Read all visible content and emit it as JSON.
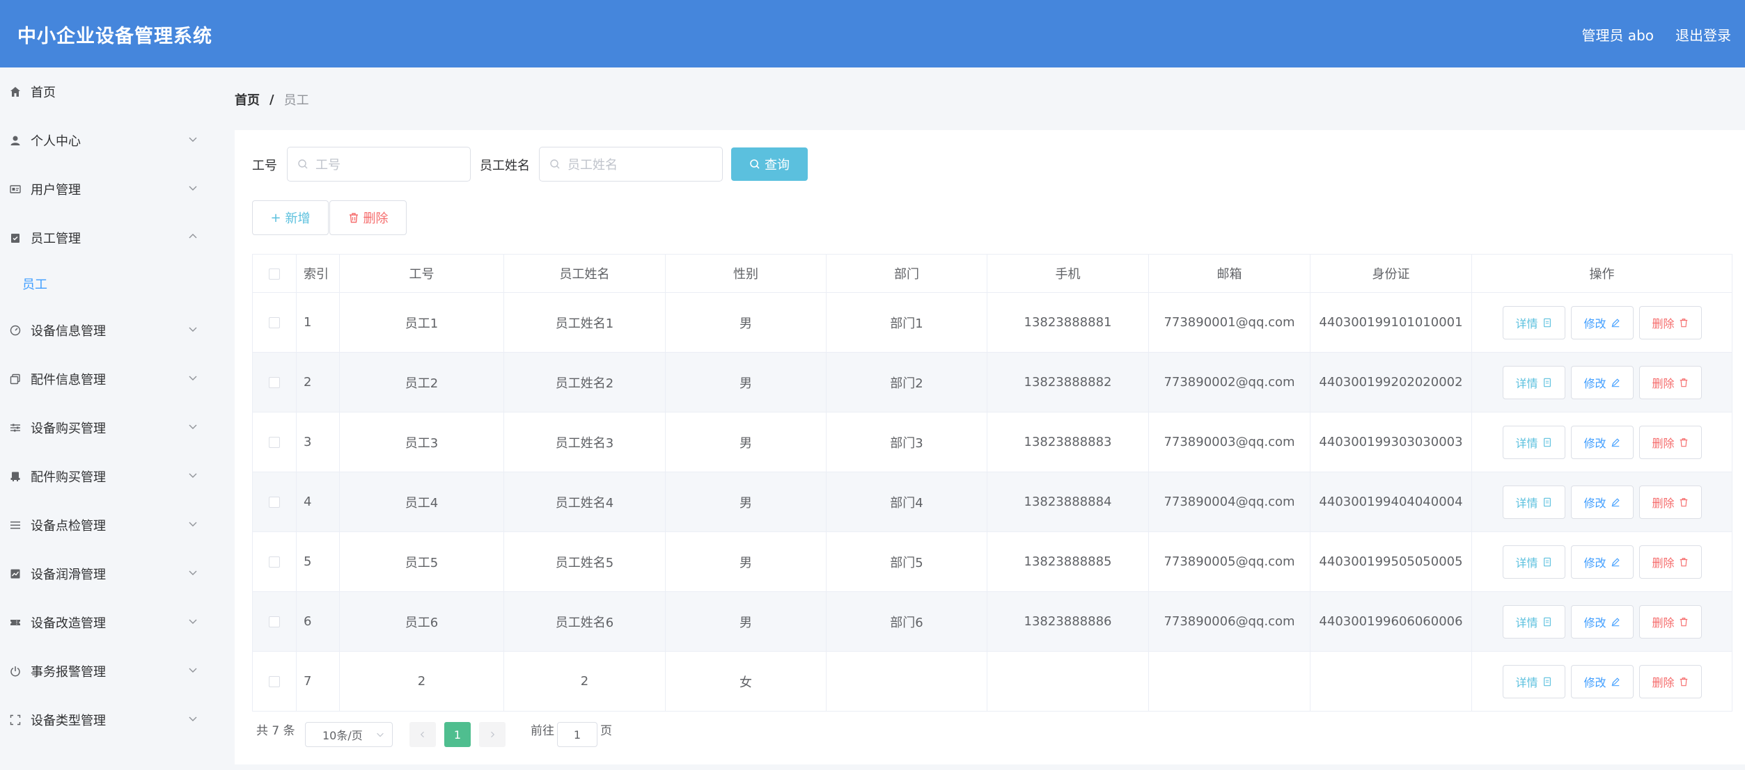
{
  "header": {
    "title": "中小企业设备管理系统",
    "user": "管理员 abo",
    "logout": "退出登录"
  },
  "sidebar": {
    "items": [
      {
        "label": "首页",
        "icon": "home-icon"
      },
      {
        "label": "个人中心",
        "icon": "user-icon"
      },
      {
        "label": "用户管理",
        "icon": "id-card-icon"
      },
      {
        "label": "员工管理",
        "icon": "clipboard-icon",
        "expanded": true
      },
      {
        "label": "设备信息管理",
        "icon": "gauge-icon"
      },
      {
        "label": "配件信息管理",
        "icon": "copy-icon"
      },
      {
        "label": "设备购买管理",
        "icon": "sliders-icon"
      },
      {
        "label": "配件购买管理",
        "icon": "printer-icon"
      },
      {
        "label": "设备点检管理",
        "icon": "list-icon"
      },
      {
        "label": "设备润滑管理",
        "icon": "chart-icon"
      },
      {
        "label": "设备改造管理",
        "icon": "ticket-icon"
      },
      {
        "label": "事务报警管理",
        "icon": "power-icon"
      },
      {
        "label": "设备类型管理",
        "icon": "fullscreen-icon"
      }
    ],
    "sub_item": "员工"
  },
  "breadcrumb": {
    "home": "首页",
    "sep": "/",
    "current": "员工"
  },
  "search": {
    "id_label": "工号",
    "id_placeholder": "工号",
    "name_label": "员工姓名",
    "name_placeholder": "员工姓名",
    "query_button": "查询"
  },
  "actions": {
    "add": "新增",
    "delete": "删除"
  },
  "table": {
    "headers": [
      "索引",
      "工号",
      "员工姓名",
      "性别",
      "部门",
      "手机",
      "邮箱",
      "身份证",
      "操作"
    ],
    "rows": [
      [
        "1",
        "员工1",
        "员工姓名1",
        "男",
        "部门1",
        "13823888881",
        "773890001@qq.com",
        "440300199101010001"
      ],
      [
        "2",
        "员工2",
        "员工姓名2",
        "男",
        "部门2",
        "13823888882",
        "773890002@qq.com",
        "440300199202020002"
      ],
      [
        "3",
        "员工3",
        "员工姓名3",
        "男",
        "部门3",
        "13823888883",
        "773890003@qq.com",
        "440300199303030003"
      ],
      [
        "4",
        "员工4",
        "员工姓名4",
        "男",
        "部门4",
        "13823888884",
        "773890004@qq.com",
        "440300199404040004"
      ],
      [
        "5",
        "员工5",
        "员工姓名5",
        "男",
        "部门5",
        "13823888885",
        "773890005@qq.com",
        "440300199505050005"
      ],
      [
        "6",
        "员工6",
        "员工姓名6",
        "男",
        "部门6",
        "13823888886",
        "773890006@qq.com",
        "440300199606060006"
      ],
      [
        "7",
        "2",
        "2",
        "女",
        "",
        "",
        "",
        ""
      ]
    ],
    "ops": {
      "detail": "详情",
      "edit": "修改",
      "remove": "删除"
    }
  },
  "pagination": {
    "total": "共 7 条",
    "page_size": "10条/页",
    "current": "1",
    "goto_prefix": "前往",
    "goto_value": "1",
    "goto_suffix": "页"
  },
  "colors": {
    "header": "#4586dc",
    "query": "#5bc0de",
    "danger": "#f56c6c",
    "primary": "#409eff",
    "page_active": "#4fbe8f"
  }
}
